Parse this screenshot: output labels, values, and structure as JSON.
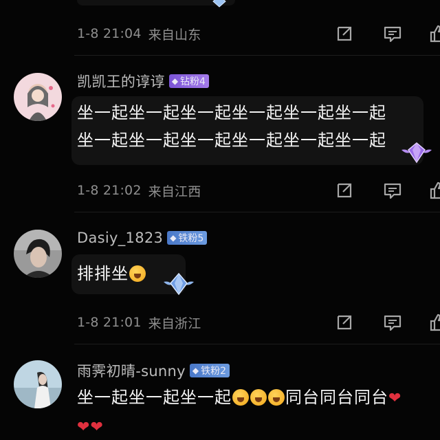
{
  "comments": [
    {
      "time": "1-8 21:04",
      "location": "来自山东"
    },
    {
      "username": "凯凯王的谆谆",
      "badge": "钻粉4",
      "lines": [
        "坐一起坐一起坐一起坐一起坐一起坐一起",
        "坐一起坐一起坐一起坐一起坐一起坐一起"
      ],
      "time": "1-8 21:02",
      "location": "来自江西",
      "badge_color": "#8c63de",
      "avatar_icon": "cartoon-girl-avatar"
    },
    {
      "username": "Dasiy_1823",
      "badge": "铁粉5",
      "text": "排排坐",
      "emoji": "crying-face-emoji",
      "time": "1-8 21:01",
      "location": "来自浙江",
      "badge_color": "#5a88d2",
      "avatar_icon": "person-photo-avatar"
    },
    {
      "username": "雨霁初晴-sunny",
      "badge": "铁粉2",
      "text_part1": "坐一起坐一起坐一起",
      "text_part2": "同台同台同台",
      "emoji": "loudly-crying-emoji",
      "heart": "red-heart-emoji",
      "badge_color": "#5a88d2",
      "avatar_icon": "person-photo-avatar"
    }
  ],
  "icons": {
    "share": "share-icon",
    "comment": "comment-icon",
    "like": "thumbs-up-icon"
  },
  "colors": {
    "background": "#050505",
    "meta_text": "#8f8f8f",
    "heart": "#e0303e"
  }
}
